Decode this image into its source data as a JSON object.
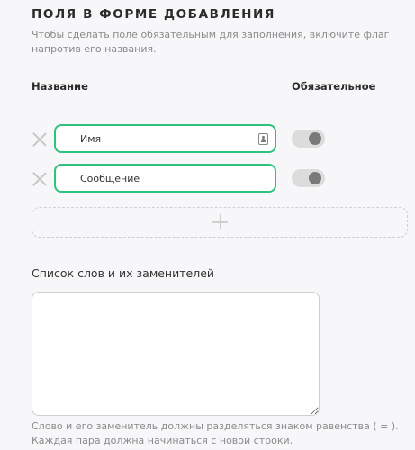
{
  "section": {
    "title": "ПОЛЯ В ФОРМЕ ДОБАВЛЕНИЯ",
    "description": "Чтобы сделать поле обязательным для заполнения, включите флаг напротив его названия."
  },
  "columns": {
    "name": "Название",
    "required": "Обязательное"
  },
  "fields": [
    {
      "value": "Имя",
      "required": false,
      "has_key_icon": true
    },
    {
      "value": "Сообщение",
      "required": false,
      "has_key_icon": false
    }
  ],
  "add_field": {
    "icon": "plus-icon"
  },
  "replacements": {
    "label": "Список слов и их заменителей",
    "value": "",
    "hint": "Слово и его заменитель должны разделяться знаком равенства ( = ). Каждая пара должна начинаться с новой строки."
  },
  "colors": {
    "accent": "#2ec27e",
    "toggle_track": "#dcdcdc",
    "toggle_knob": "#7a7a7a",
    "background": "#f7f7f9"
  }
}
